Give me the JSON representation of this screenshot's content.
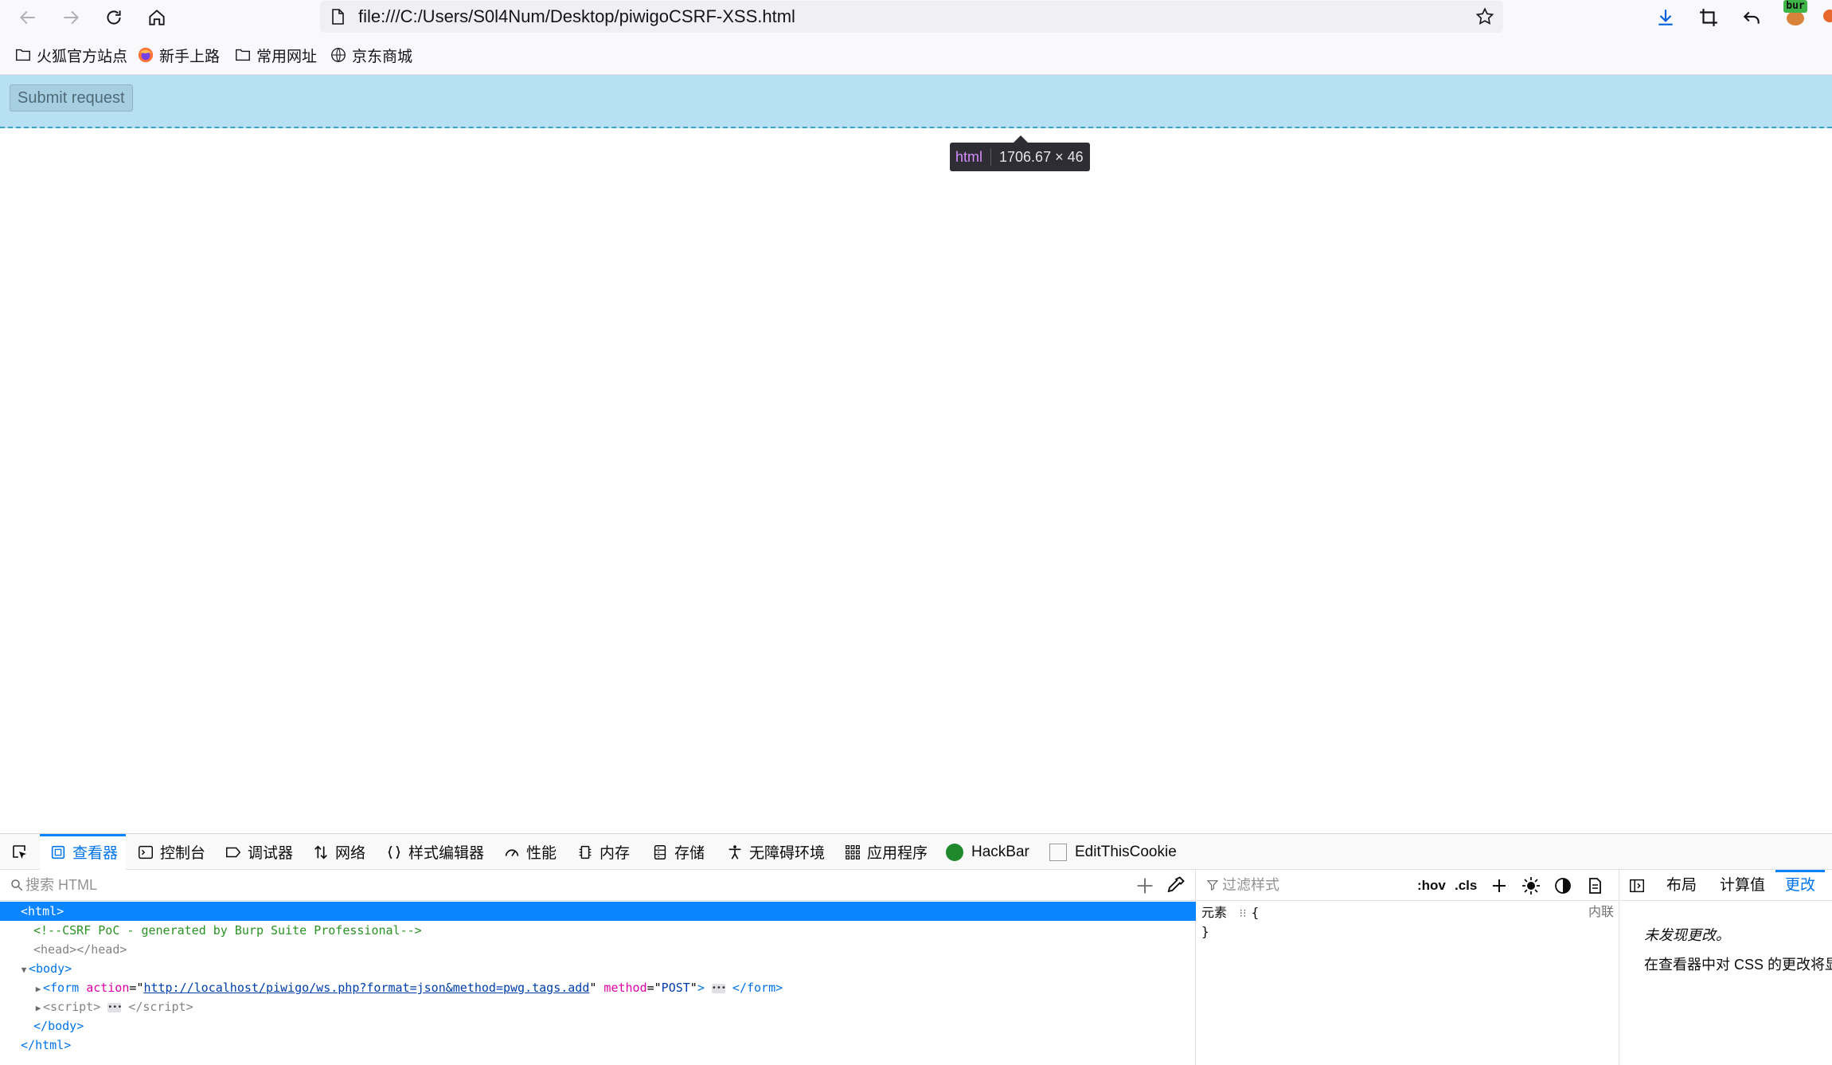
{
  "browser": {
    "url": "file:///C:/Users/S0l4Num/Desktop/piwigoCSRF-XSS.html",
    "extension_badge": "bur"
  },
  "bookmarks": [
    {
      "label": "火狐官方站点",
      "icon": "folder-icon"
    },
    {
      "label": "新手上路",
      "icon": "firefox-icon"
    },
    {
      "label": "常用网址",
      "icon": "folder-icon"
    },
    {
      "label": "京东商城",
      "icon": "globe-icon"
    }
  ],
  "page": {
    "submit_label": "Submit request",
    "infobar_tag": "html",
    "infobar_dims": "1706.67 × 46"
  },
  "devtools": {
    "tabs": [
      {
        "label": "查看器",
        "icon": "inspector-icon",
        "active": true
      },
      {
        "label": "控制台",
        "icon": "console-icon"
      },
      {
        "label": "调试器",
        "icon": "debugger-icon"
      },
      {
        "label": "网络",
        "icon": "network-icon"
      },
      {
        "label": "样式编辑器",
        "icon": "style-editor-icon"
      },
      {
        "label": "性能",
        "icon": "performance-icon"
      },
      {
        "label": "内存",
        "icon": "memory-icon"
      },
      {
        "label": "存储",
        "icon": "storage-icon"
      },
      {
        "label": "无障碍环境",
        "icon": "accessibility-icon"
      },
      {
        "label": "应用程序",
        "icon": "application-icon"
      },
      {
        "label": "HackBar",
        "icon": "hackbar-icon"
      },
      {
        "label": "EditThisCookie",
        "icon": "editthiscookie-icon"
      }
    ],
    "markup": {
      "search_placeholder": "搜索 HTML",
      "html_open": "<html>",
      "comment": "<!--CSRF PoC - generated by Burp Suite Professional-->",
      "head_open": "<head>",
      "head_close": "</head>",
      "body_tag": "body",
      "form_tag": "form",
      "form_action_attr": "action",
      "form_action_value": "http://localhost/piwigo/ws.php?format=json&method=pwg.tags.add",
      "form_method_attr": "method",
      "form_method_value": "POST",
      "script_tag": "script",
      "html_tag": "html"
    },
    "rules": {
      "filter_placeholder": "过滤样式",
      "hov": ":hov",
      "cls": ".cls",
      "element_label": "元素",
      "open_brace": "{",
      "close_brace": "}",
      "source": "内联"
    },
    "side": {
      "tab_layout": "布局",
      "tab_computed": "计算值",
      "tab_changes": "更改",
      "msg_no_changes": "未发现更改。",
      "msg_hint": "在查看器中对 CSS 的更改将显示在此处。"
    }
  }
}
